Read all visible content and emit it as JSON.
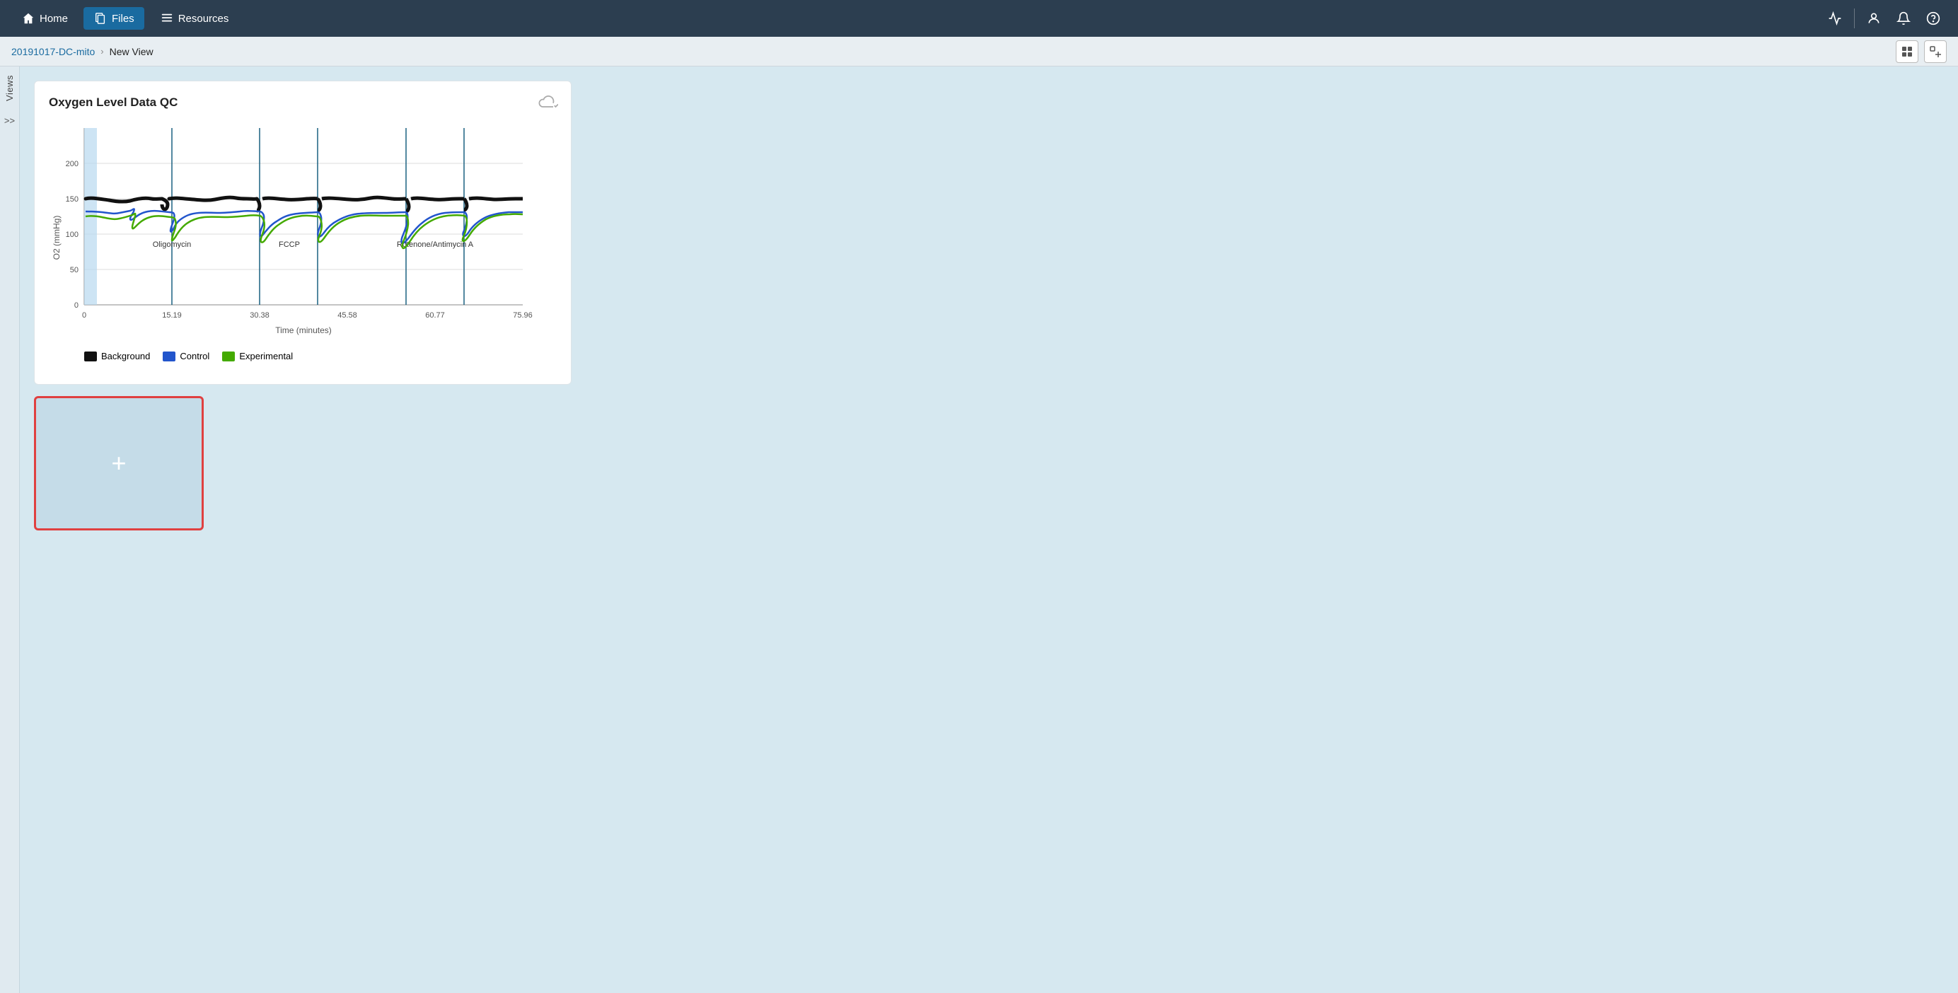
{
  "nav": {
    "home_label": "Home",
    "files_label": "Files",
    "resources_label": "Resources"
  },
  "breadcrumb": {
    "parent": "20191017-DC-mito",
    "separator": "›",
    "current": "New View"
  },
  "chart": {
    "title": "Oxygen Level Data QC",
    "y_axis_label": "O2 (mmHg)",
    "x_axis_label": "Time (minutes)",
    "x_ticks": [
      "0",
      "15.19",
      "30.38",
      "45.58",
      "60.77",
      "75.96"
    ],
    "y_ticks": [
      "0",
      "50",
      "100",
      "150",
      "200"
    ],
    "injections": [
      "Oligomycin",
      "FCCP",
      "Rotenone/Antimycin A"
    ],
    "legend": [
      {
        "label": "Background",
        "color": "#111111"
      },
      {
        "label": "Control",
        "color": "#2255cc"
      },
      {
        "label": "Experimental",
        "color": "#44aa00"
      }
    ]
  },
  "add_panel": {
    "plus_symbol": "+"
  },
  "views_sidebar": {
    "label": "Views",
    "expand_symbol": ">>"
  }
}
